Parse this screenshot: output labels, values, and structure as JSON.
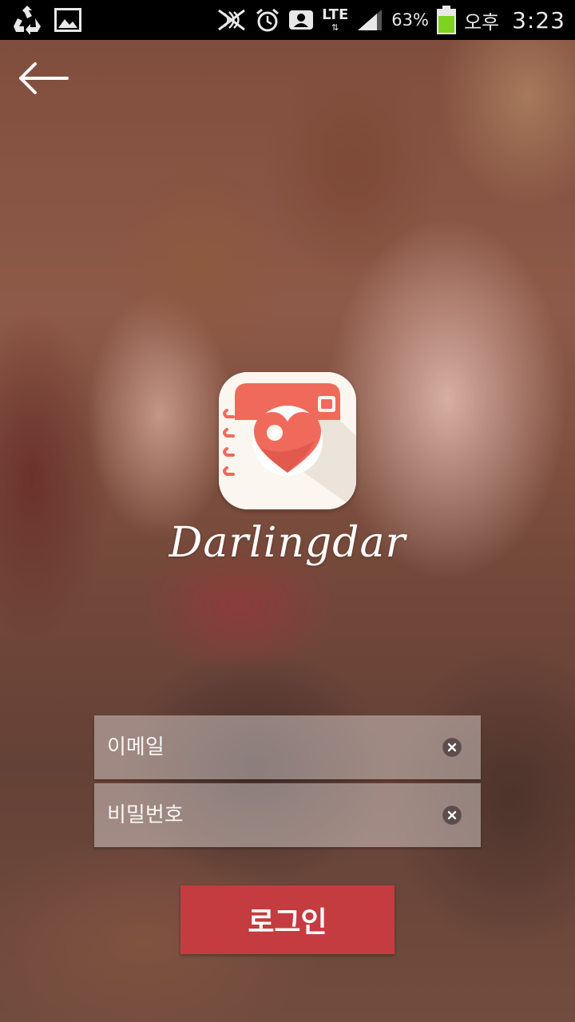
{
  "status_bar": {
    "icons": [
      "recycle-icon",
      "image-icon",
      "nfc-icon",
      "alarm-icon",
      "contact-icon",
      "lte-icon",
      "signal-icon",
      "battery-icon"
    ],
    "network": "LTE",
    "battery_percent": "63%",
    "ampm": "오후",
    "time": "3:23"
  },
  "nav": {
    "back_icon": "arrow-left-icon"
  },
  "brand": {
    "name": "Darlingdar",
    "logo_icon": "heart-camera-icon"
  },
  "form": {
    "email_placeholder": "이메일",
    "password_placeholder": "비밀번호",
    "clear_icon": "clear-x-icon"
  },
  "login": {
    "label": "로그인"
  },
  "colors": {
    "accent": "#c43c40",
    "logo_bg": "#fbf6ef",
    "logo_band": "#f06a5c"
  }
}
